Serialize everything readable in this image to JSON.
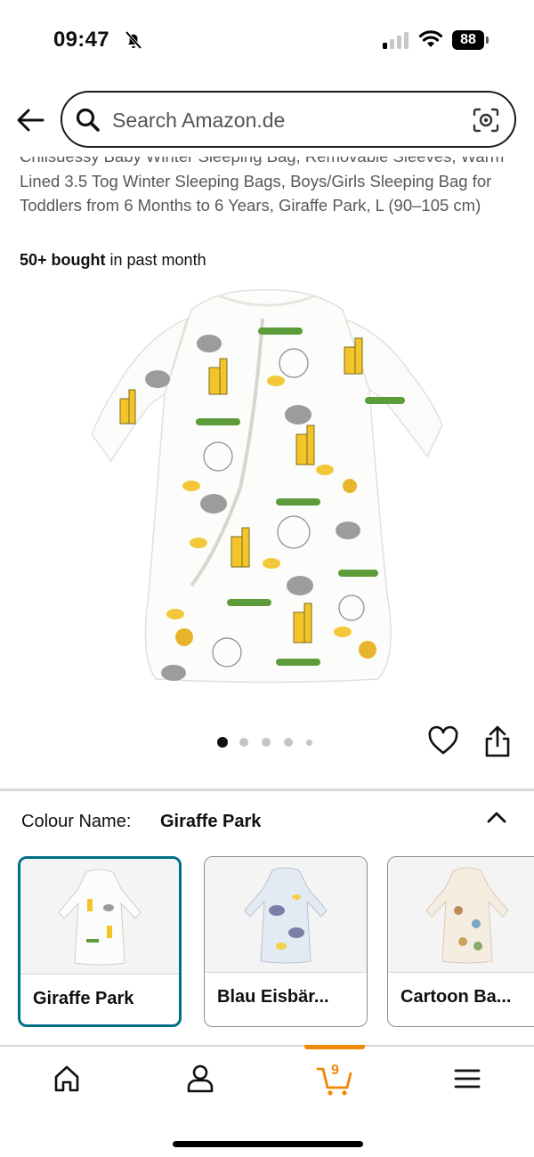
{
  "status_bar": {
    "time": "09:47",
    "battery": "88"
  },
  "search": {
    "placeholder": "Search Amazon.de"
  },
  "product": {
    "title": "Chilsuessy Baby Winter Sleeping Bag, Removable Sleeves, Warm Lined 3.5 Tog Winter Sleeping Bags, Boys/Girls Sleeping Bag for Toddlers from 6 Months to 6 Years, Giraffe Park, L (90–105 cm)",
    "bought_count": "50+ bought",
    "bought_suffix": " in past month",
    "image_count": 5,
    "active_image_index": 0
  },
  "colour": {
    "label": "Colour Name:",
    "selected": "Giraffe Park",
    "options": [
      {
        "label": "Giraffe Park"
      },
      {
        "label": "Blau Eisbär..."
      },
      {
        "label": "Cartoon Ba..."
      }
    ]
  },
  "bottom_nav": {
    "items": [
      {
        "icon": "home-icon"
      },
      {
        "icon": "account-icon"
      },
      {
        "icon": "cart-icon"
      },
      {
        "icon": "menu-icon"
      }
    ],
    "cart_count": "9"
  },
  "colors": {
    "accent_teal": "#007185",
    "cart_orange": "#f08804",
    "text_secondary": "#565959"
  }
}
